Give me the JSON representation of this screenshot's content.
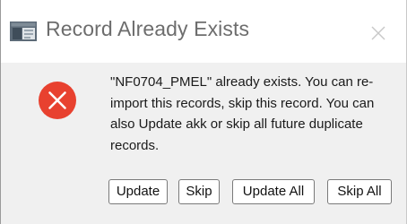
{
  "window": {
    "title": "Record Already Exists"
  },
  "icons": {
    "app": "app-window-icon",
    "close": "close-icon",
    "error": "error-icon"
  },
  "message": {
    "text": "\"NF0704_PMEL\" already exists. You can re-import this records, skip this record. You can also Update akk or skip all future duplicate records."
  },
  "buttons": {
    "update": "Update",
    "skip": "Skip",
    "update_all": "Update All",
    "skip_all": "Skip All"
  },
  "colors": {
    "error_red": "#e8412f",
    "dialog_bg": "#f0f0f0",
    "titlebar_bg": "#ffffff"
  }
}
